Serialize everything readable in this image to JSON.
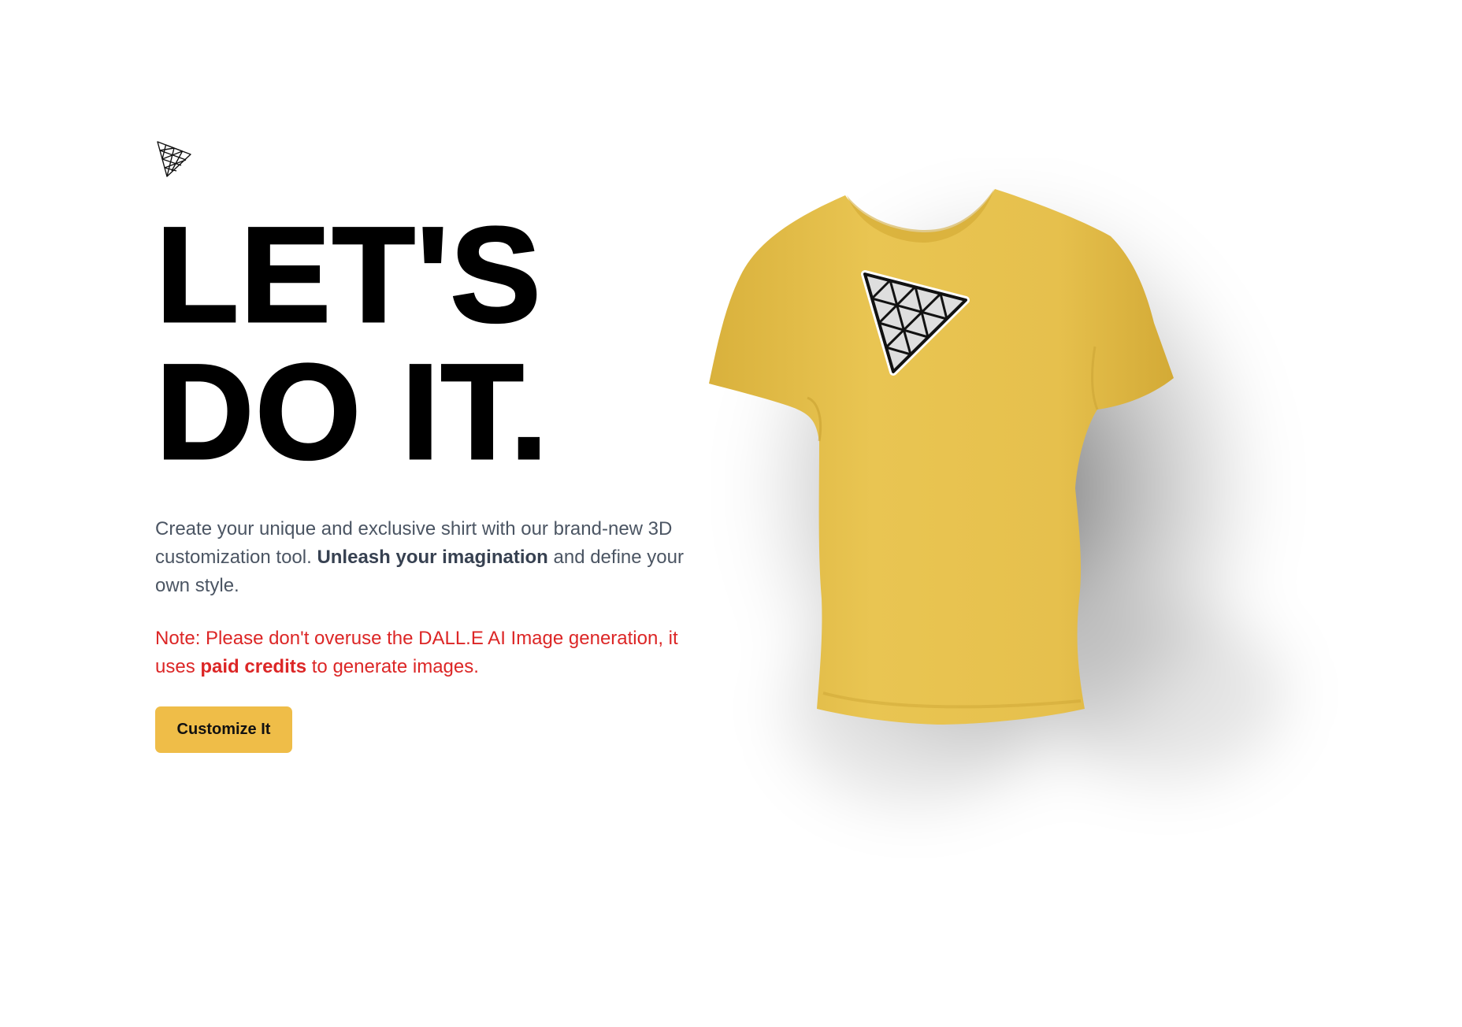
{
  "logo": {
    "icon": "threejs-triangle-logo-icon"
  },
  "hero": {
    "headline_line1": "LET'S",
    "headline_line2": "DO IT."
  },
  "description": {
    "part1": "Create your unique and exclusive shirt with our brand-new 3D customization tool.",
    "emphasis": "Unleash your imagination",
    "part2": "and define your own style."
  },
  "note": {
    "part1": "Note: Please don't overuse the DALL.E AI Image generation, it uses",
    "emphasis": "paid credits",
    "part2": "to generate images."
  },
  "cta": {
    "label": "Customize It"
  },
  "shirt": {
    "color": "#e8c24f",
    "decal_icon": "threejs-triangle-logo-icon"
  },
  "colors": {
    "accent": "#efbd48",
    "note_text": "#dc2626",
    "body_text": "#4b5563"
  }
}
